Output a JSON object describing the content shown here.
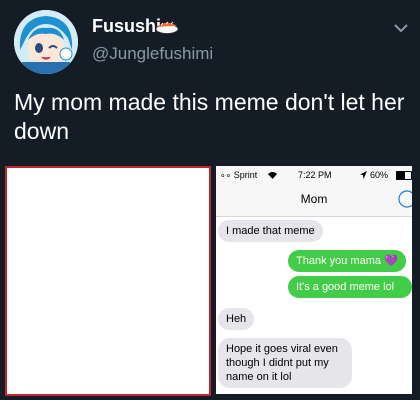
{
  "tweet": {
    "display_name": "Fusushi",
    "handle": "@Junglefushimi",
    "text": "My mom made this meme don't let her down",
    "name_icon": "sushi-icon",
    "menu_icon": "chevron-down-icon"
  },
  "phone": {
    "carrier": "∘∘ Sprint",
    "time": "7:22 PM",
    "battery": "60%",
    "contact": "Mom",
    "messages": [
      {
        "from": "received",
        "text": "I made that meme"
      },
      {
        "from": "sent",
        "text": "Thank you mama 💜"
      },
      {
        "from": "sent",
        "text": "It's a good meme lol"
      },
      {
        "from": "received",
        "text": "Heh"
      },
      {
        "from": "received",
        "text": "Hope it goes viral even though I didnt put my name on it lol"
      }
    ]
  },
  "colors": {
    "background": "#141d26",
    "meme_border": "#c2262e",
    "sent_bubble": "#43cc47",
    "received_bubble": "#e5e5ea"
  }
}
